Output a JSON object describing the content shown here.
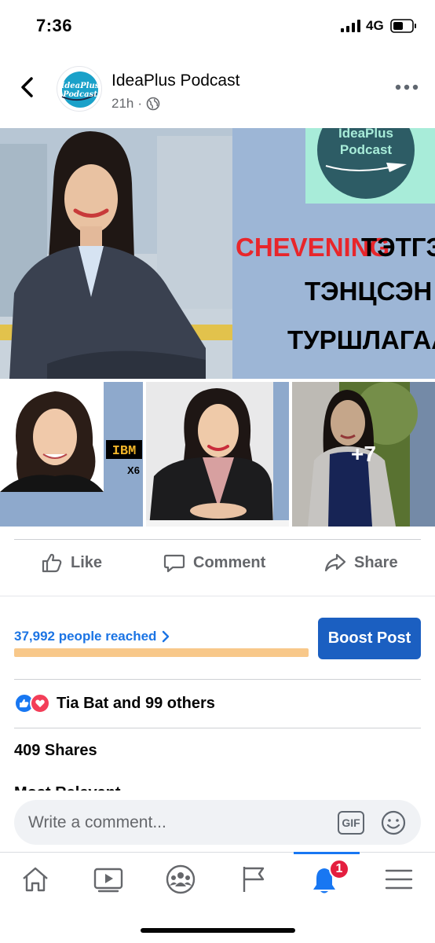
{
  "status_bar": {
    "time": "7:36",
    "network": "4G"
  },
  "header": {
    "page_name": "IdeaPlus Podcast",
    "timestamp": "21h",
    "separator": "·",
    "avatar_text_line1": "IdeaPlus",
    "avatar_text_line2": "Podcast"
  },
  "post_images": {
    "hero": {
      "logo_line1": "IdeaPlus",
      "logo_line2": "Podcast",
      "headline_red": "CHEVENING",
      "headline_black_1": "ТЭТГЭ",
      "headline_black_2": "ТЭНЦСЭН",
      "headline_black_3": "ТУРШЛАГААС"
    },
    "thumb1_brand": "IBM",
    "thumb1_partial": "Х6",
    "more_count": "+7"
  },
  "actions": {
    "like": "Like",
    "comment": "Comment",
    "share": "Share"
  },
  "insights": {
    "reach": "37,992 people reached",
    "boost": "Boost Post",
    "reach_fraction": 0.72
  },
  "reactions_text": "Tia Bat and 99 others",
  "shares_text": "409 Shares",
  "most_relevant_text": "Most Relevant",
  "comment_box": {
    "placeholder": "Write a comment...",
    "gif_label": "GIF"
  },
  "nav": {
    "notification_badge": "1",
    "active_tab": "notifications"
  },
  "colors": {
    "accent": "#1877f2",
    "boost_button": "#1b5fc1",
    "reach_bar": "#f8c88a",
    "badge": "#e41e3f",
    "headline_red": "#e8262b",
    "hero_panel": "#9db6d6"
  }
}
